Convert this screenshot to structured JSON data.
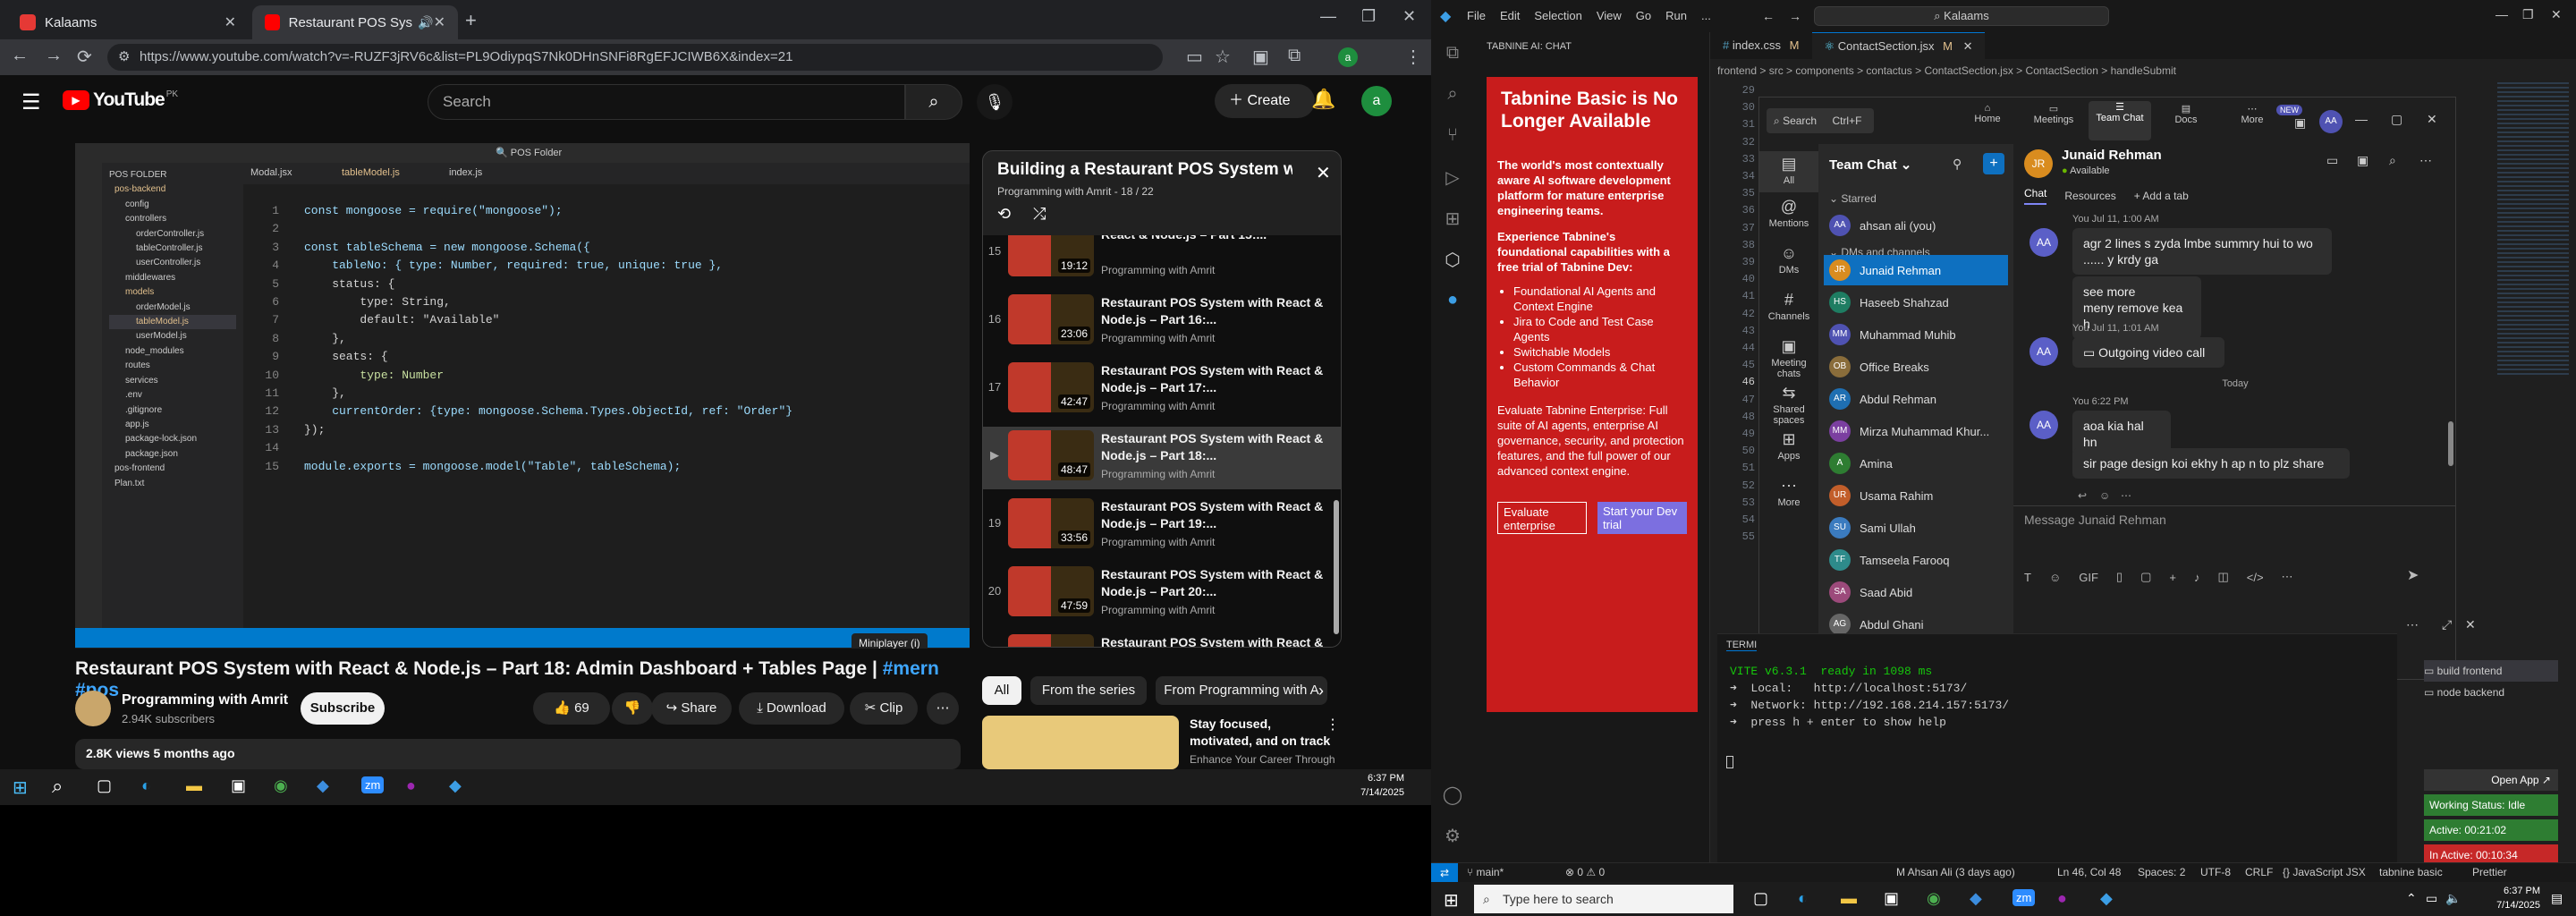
{
  "chrome": {
    "tabs": [
      {
        "label": "Kalaams"
      },
      {
        "label": "Restaurant POS System wit"
      }
    ],
    "url": "https://www.youtube.com/watch?v=-RUZF3jRV6c&list=PL9OdiypqS7Nk0DHnSNFi8RgEFJCIWB6X&index=21"
  },
  "youtube": {
    "logo_text": "YouTube",
    "logo_suffix": "PK",
    "search_placeholder": "Search",
    "create_label": "Create",
    "avatar_letter": "a",
    "player": {
      "code_lines": [
        {
          "n": "1",
          "text": "const mongoose = require(\"mongoose\");"
        },
        {
          "n": "2",
          "text": ""
        },
        {
          "n": "3",
          "text": "const tableSchema = new mongoose.Schema({"
        },
        {
          "n": "4",
          "text": "    tableNo: { type: Number, required: true, unique: true },"
        },
        {
          "n": "5",
          "text": "    status: {"
        },
        {
          "n": "6",
          "text": "        type: String,"
        },
        {
          "n": "7",
          "text": "        default: \"Available\""
        },
        {
          "n": "8",
          "text": "    },"
        },
        {
          "n": "9",
          "text": "    seats: {"
        },
        {
          "n": "10",
          "text": "        type: Number"
        },
        {
          "n": "11",
          "text": "    },"
        },
        {
          "n": "12",
          "text": "    currentOrder: {type: mongoose.Schema.Types.ObjectId, ref: \"Order\"}"
        },
        {
          "n": "13",
          "text": "});"
        },
        {
          "n": "14",
          "text": ""
        },
        {
          "n": "15",
          "text": "module.exports = mongoose.model(\"Table\", tableSchema);"
        }
      ],
      "explorer_items": [
        "POS FOLDER",
        "pos-backend",
        "config",
        "controllers",
        "orderController.js",
        "tableController.js",
        "userController.js",
        "middlewares",
        "models",
        "orderModel.js",
        "tableModel.js",
        "userModel.js",
        "node_modules",
        "routes",
        "services",
        ".env",
        ".gitignore",
        "app.js",
        "package-lock.json",
        "package.json",
        "pos-frontend",
        "Plan.txt"
      ],
      "tooltip": "Miniplayer (i)"
    },
    "video_title": "Restaurant POS System with React & Node.js – Part 18: Admin Dashboard + Tables Page |",
    "video_hashtags": "#mern #pos",
    "channel": {
      "name": "Programming with Amrit",
      "subscribers": "2.94K subscribers",
      "subscribe_label": "Subscribe"
    },
    "actions": {
      "likes": "69",
      "share": "Share",
      "download": "Download",
      "clip": "Clip"
    },
    "meta": "2.8K views  5 months ago",
    "playlist": {
      "title": "Building a Restaurant POS System w...",
      "subtitle": "Programming with Amrit - 18 / 22",
      "items": [
        {
          "idx": "15",
          "title": "React & Node.js – Part 15:...",
          "author": "Programming with Amrit",
          "duration": "19:12"
        },
        {
          "idx": "16",
          "title": "Restaurant POS System with React & Node.js – Part 16:...",
          "author": "Programming with Amrit",
          "duration": "23:06"
        },
        {
          "idx": "17",
          "title": "Restaurant POS System with React & Node.js – Part 17:...",
          "author": "Programming with Amrit",
          "duration": "42:47"
        },
        {
          "idx": "▶",
          "title": "Restaurant POS System with React & Node.js – Part 18:...",
          "author": "Programming with Amrit",
          "duration": "48:47"
        },
        {
          "idx": "19",
          "title": "Restaurant POS System with React & Node.js – Part 19:...",
          "author": "Programming with Amrit",
          "duration": "33:56"
        },
        {
          "idx": "20",
          "title": "Restaurant POS System with React & Node.js – Part 20:...",
          "author": "Programming with Amrit",
          "duration": "47:59"
        },
        {
          "idx": "21",
          "title": "Restaurant POS System with React & Node.js – Part 21:...",
          "author": "Programming with Amrit",
          "duration": "7:06"
        }
      ]
    },
    "filter_chips": [
      "All",
      "From the series",
      "From Programming with A"
    ],
    "rec": {
      "title": "Stay focused, motivated, and on track",
      "sub": "Enhance Your Career Through"
    }
  },
  "taskbar_left": {
    "time": "6:37 PM",
    "date": "7/14/2025"
  },
  "vscode": {
    "menu": [
      "File",
      "Edit",
      "Selection",
      "View",
      "Go",
      "Run",
      "..."
    ],
    "command_center": "Kalaams",
    "tabs": [
      {
        "label": "index.css",
        "badge": "M"
      },
      {
        "label": "ContactSection.jsx",
        "badge": "M"
      }
    ],
    "breadcrumb": "frontend > src > components > contactus > ContactSection.jsx > ContactSection > handleSubmit",
    "line_numbers": [
      "29",
      "30",
      "31",
      "32",
      "33",
      "34",
      "35",
      "36",
      "37",
      "38",
      "39",
      "40",
      "41",
      "42",
      "43",
      "44",
      "45",
      "46",
      "47",
      "48",
      "49",
      "50",
      "51",
      "52",
      "53",
      "54",
      "55"
    ],
    "tabnine": {
      "header": "TABNINE AI: CHAT",
      "headline": "Tabnine Basic is No Longer Available",
      "p1": "The world's most contextually aware AI software development platform for mature enterprise engineering teams.",
      "p2": "Experience Tabnine's foundational capabilities with a free trial of Tabnine Dev:",
      "bullets": [
        "Foundational AI Agents and Context Engine",
        "Jira to Code and Test Case Agents",
        "Switchable Models",
        "Custom Commands & Chat Behavior"
      ],
      "p3": "Evaluate Tabnine Enterprise: Full suite of AI agents, enterprise AI governance, security, and protection features, and the full power of our advanced context engine.",
      "btn_eval": "Evaluate enterprise",
      "btn_trial": "Start your Dev trial"
    },
    "terminal": {
      "tab": "TERMI",
      "lines": [
        "VITE v6.3.1  ready in 1098 ms",
        "➜  Local:   http://localhost:5173/",
        "➜  Network: http://192.168.214.157:5173/",
        "➜  press h + enter to show help"
      ],
      "side_items": [
        "build frontend",
        "node backend"
      ]
    },
    "status": {
      "branch": "main*",
      "problems": "⊗ 0 ⚠ 0",
      "author": "M Ahsan Ali (3 days ago)",
      "cursor": "Ln 46, Col 48",
      "spaces": "Spaces: 2",
      "encoding": "UTF-8",
      "eol": "CRLF",
      "language": "{} JavaScript JSX",
      "extension": "tabnine basic",
      "prettier": "Prettier"
    },
    "badges": {
      "open_app": "Open App ↗",
      "working": "Working Status: Idle",
      "active": "Active: 00:21:02",
      "inactive": "In Active: 00:10:34"
    }
  },
  "teams": {
    "search": "Search",
    "search_shortcut": "Ctrl+F",
    "nav": [
      "Home",
      "Meetings",
      "Team Chat",
      "Docs",
      "More"
    ],
    "new_badge": "NEW",
    "rail": [
      "All",
      "Mentions",
      "DMs",
      "Channels",
      "Meeting chats",
      "Shared spaces",
      "Apps",
      "More"
    ],
    "list_title": "Team Chat",
    "sections": {
      "starred": "Starred",
      "dms": "DMs and channels"
    },
    "starred_contact": {
      "name": "ahsan ali (you)",
      "initials": "AA"
    },
    "contacts": [
      {
        "name": "Junaid Rehman",
        "initials": "JR"
      },
      {
        "name": "Haseeb Shahzad",
        "initials": "HS"
      },
      {
        "name": "Muhammad Muhib",
        "initials": "MM"
      },
      {
        "name": "Office Breaks",
        "initials": "OB"
      },
      {
        "name": "Abdul Rehman",
        "initials": "AR"
      },
      {
        "name": "Mirza Muhammad Khur...",
        "initials": "MM"
      },
      {
        "name": "Amina",
        "initials": "A"
      },
      {
        "name": "Usama Rahim",
        "initials": "UR"
      },
      {
        "name": "Sami Ullah",
        "initials": "SU"
      },
      {
        "name": "Tamseela Farooq",
        "initials": "TF"
      },
      {
        "name": "Saad Abid",
        "initials": "SA"
      },
      {
        "name": "Abdul Ghani",
        "initials": "AG"
      }
    ],
    "chat": {
      "name": "Junaid Rehman",
      "status": "Available",
      "tabs": [
        "Chat",
        "Resources",
        "+ Add a tab"
      ],
      "meta1": "You Jul 11, 1:00 AM",
      "msg1": "agr 2 lines s zyda lmbe summry hui to wo ...... y krdy ga",
      "msg2": "see more\nmeny remove kea h",
      "meta2": "You Jul 11, 1:01 AM",
      "msg3": "Outgoing video call",
      "today": "Today",
      "meta3": "You 6:22 PM",
      "msg4": "aoa kia hal hn",
      "msg5": "sir page design koi ekhy h ap n to plz share",
      "compose": "Message Junaid Rehman",
      "initials": "AA"
    }
  },
  "taskbar_right": {
    "search": "Type here to search",
    "time": "6:37 PM",
    "date": "7/14/2025"
  }
}
